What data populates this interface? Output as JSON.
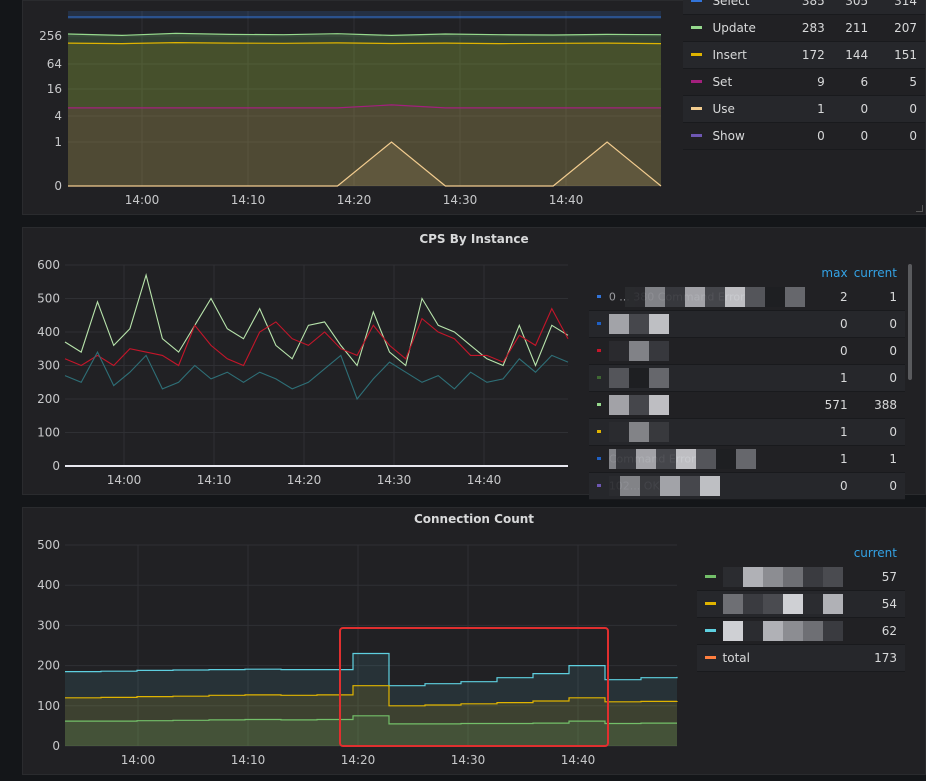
{
  "panels": {
    "top": {
      "y_ticks": [
        "256",
        "64",
        "16",
        "4",
        "1",
        "0"
      ],
      "x_ticks": [
        "14:00",
        "14:10",
        "14:20",
        "14:30",
        "14:40"
      ],
      "legend": [
        {
          "name": "Select",
          "max": "385",
          "min": "305",
          "current": "314",
          "color": "#3274d9"
        },
        {
          "name": "Update",
          "max": "283",
          "min": "211",
          "current": "207",
          "color": "#96d98d"
        },
        {
          "name": "Insert",
          "max": "172",
          "min": "144",
          "current": "151",
          "color": "#e0b400"
        },
        {
          "name": "Set",
          "max": "9",
          "min": "6",
          "current": "5",
          "color": "#a3207d"
        },
        {
          "name": "Use",
          "max": "1",
          "min": "0",
          "current": "0",
          "color": "#f2cc8f"
        },
        {
          "name": "Show",
          "max": "0",
          "min": "0",
          "current": "0",
          "color": "#6e57b3"
        }
      ]
    },
    "cps": {
      "title": "CPS By Instance",
      "y_ticks": [
        "600",
        "500",
        "400",
        "300",
        "200",
        "100",
        "0"
      ],
      "x_ticks": [
        "14:00",
        "14:10",
        "14:20",
        "14:30",
        "14:40"
      ],
      "legend_headers": {
        "max": "max",
        "current": "current"
      },
      "legend": [
        {
          "name": "0 ... 380 Command Error",
          "max": "2",
          "current": "1",
          "color": "#3274d9"
        },
        {
          "name": "",
          "max": "0",
          "current": "0",
          "color": "#1f60c4"
        },
        {
          "name": "",
          "max": "0",
          "current": "0",
          "color": "#c4162a"
        },
        {
          "name": "",
          "max": "1",
          "current": "0",
          "color": "#3f6833"
        },
        {
          "name": "",
          "max": "571",
          "current": "388",
          "color": "#96d98d"
        },
        {
          "name": "",
          "max": "1",
          "current": "0",
          "color": "#e0b400"
        },
        {
          "name": "Command Error",
          "max": "1",
          "current": "1",
          "color": "#1f60c4"
        },
        {
          "name": "102... OK",
          "max": "0",
          "current": "0",
          "color": "#6e57b3"
        }
      ]
    },
    "conn": {
      "title": "Connection Count",
      "y_ticks": [
        "500",
        "400",
        "300",
        "200",
        "100",
        "0"
      ],
      "x_ticks": [
        "14:00",
        "14:10",
        "14:20",
        "14:30",
        "14:40"
      ],
      "legend_headers": {
        "current": "current"
      },
      "legend": [
        {
          "name": "",
          "current": "57",
          "color": "#73bf69"
        },
        {
          "name": "",
          "current": "54",
          "color": "#e0b400"
        },
        {
          "name": "",
          "current": "62",
          "color": "#5ed0e0"
        },
        {
          "name": "total",
          "current": "173",
          "color": "#ff7f3f"
        }
      ]
    }
  },
  "chart_data": [
    {
      "type": "area",
      "title": "",
      "y_scale": "log2",
      "x_ticks": [
        "14:00",
        "14:10",
        "14:20",
        "14:30",
        "14:40"
      ],
      "series": [
        {
          "name": "Update",
          "values": [
            290,
            270,
            300,
            285,
            280,
            295,
            270,
            290,
            280,
            275,
            285,
            280
          ]
        },
        {
          "name": "Insert",
          "values": [
            180,
            175,
            185,
            180,
            178,
            182,
            176,
            180,
            175,
            178,
            180,
            175
          ]
        },
        {
          "name": "Set",
          "values": [
            6,
            6,
            6,
            6,
            6,
            6,
            7,
            6,
            6,
            6,
            6,
            6
          ]
        },
        {
          "name": "Use",
          "values": [
            0,
            0,
            0,
            0,
            0,
            0,
            1,
            0,
            0,
            0,
            1,
            0
          ]
        }
      ]
    },
    {
      "type": "line",
      "title": "CPS By Instance",
      "ylim": [
        0,
        600
      ],
      "x_ticks": [
        "14:00",
        "14:10",
        "14:20",
        "14:30",
        "14:40"
      ],
      "series": [
        {
          "name": "",
          "color": "#b7e3ab",
          "values": [
            370,
            340,
            490,
            360,
            410,
            570,
            380,
            340,
            420,
            500,
            410,
            380,
            470,
            360,
            320,
            420,
            430,
            360,
            300,
            460,
            340,
            300,
            500,
            420,
            400,
            360,
            320,
            300,
            420,
            300,
            420,
            390
          ]
        },
        {
          "name": "",
          "color": "#c4162a",
          "values": [
            320,
            300,
            330,
            300,
            350,
            340,
            330,
            300,
            420,
            360,
            320,
            300,
            400,
            430,
            380,
            360,
            400,
            350,
            330,
            420,
            360,
            320,
            440,
            400,
            380,
            330,
            330,
            310,
            390,
            360,
            470,
            380
          ]
        },
        {
          "name": "",
          "color": "#2e6f77",
          "values": [
            270,
            250,
            340,
            240,
            280,
            330,
            230,
            250,
            300,
            260,
            280,
            250,
            280,
            260,
            230,
            250,
            290,
            330,
            200,
            260,
            310,
            280,
            250,
            270,
            230,
            280,
            250,
            260,
            320,
            280,
            330,
            310
          ]
        },
        {
          "name": "",
          "color": "#e8e8f0",
          "values": [
            0,
            0,
            0,
            0,
            0,
            0,
            0,
            0,
            0,
            0,
            0,
            0,
            0,
            0,
            0,
            0,
            0,
            0,
            0,
            0,
            0,
            0,
            0,
            0,
            0,
            0,
            0,
            0,
            0,
            0,
            0,
            0
          ]
        }
      ]
    },
    {
      "type": "area",
      "title": "Connection Count",
      "ylim": [
        0,
        500
      ],
      "x_ticks": [
        "14:00",
        "14:10",
        "14:20",
        "14:30",
        "14:40"
      ],
      "series": [
        {
          "name": "",
          "color": "#5ed0e0",
          "values": [
            185,
            186,
            188,
            189,
            190,
            191,
            190,
            190,
            230,
            150,
            155,
            160,
            170,
            180,
            200,
            165,
            170,
            172
          ]
        },
        {
          "name": "",
          "color": "#e0b400",
          "values": [
            120,
            121,
            123,
            124,
            126,
            127,
            126,
            127,
            150,
            100,
            102,
            105,
            108,
            112,
            120,
            110,
            111,
            112
          ]
        },
        {
          "name": "",
          "color": "#73bf69",
          "values": [
            62,
            62,
            63,
            64,
            65,
            66,
            65,
            66,
            75,
            55,
            55,
            56,
            56,
            57,
            62,
            56,
            57,
            57
          ]
        }
      ],
      "annotation": "red rectangle highlighting 14:19 to 14:43"
    }
  ]
}
